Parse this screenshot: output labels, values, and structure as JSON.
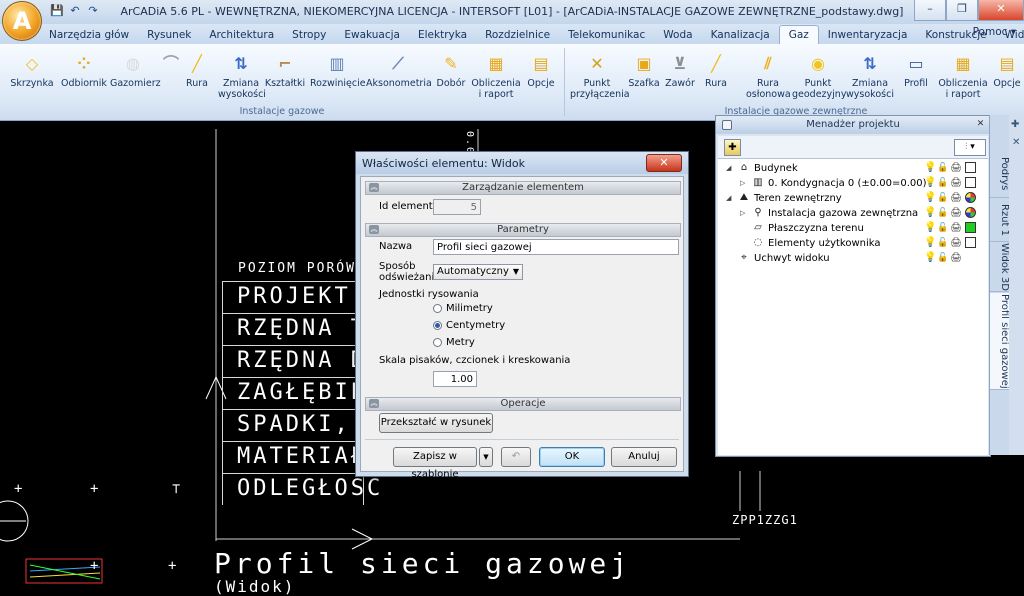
{
  "app": {
    "orb_letter": "A",
    "title": "ArCADiA 5.6 PL - WEWNĘTRZNA, NIEKOMERCYJNA LICENCJA - INTERSOFT [L01] - [ArCADiA-INSTALACJE GAZOWE ZEWNĘTRZNE_podstawy.dwg]",
    "qat": [
      "💾",
      "↶",
      "↷"
    ],
    "window_controls": [
      "–",
      "❐",
      "✕"
    ]
  },
  "ribbon": {
    "tabs": [
      {
        "label": "Narzędzia głów",
        "active": false
      },
      {
        "label": "Rysunek",
        "active": false
      },
      {
        "label": "Architektura",
        "active": false
      },
      {
        "label": "Stropy",
        "active": false
      },
      {
        "label": "Ewakuacja",
        "active": false
      },
      {
        "label": "Elektryka",
        "active": false
      },
      {
        "label": "Rozdzielnice",
        "active": false
      },
      {
        "label": "Telekomunikac",
        "active": false
      },
      {
        "label": "Woda",
        "active": false
      },
      {
        "label": "Kanalizacja",
        "active": false
      },
      {
        "label": "Gaz",
        "active": true
      },
      {
        "label": "Inwentaryzacja",
        "active": false
      },
      {
        "label": "Konstrukcje",
        "active": false
      },
      {
        "label": "Widok",
        "active": false
      }
    ],
    "help": "Pomoc",
    "group1": {
      "label": "Instalacje gazowe",
      "buttons": [
        {
          "label": "Skrzynka",
          "icon": "◇"
        },
        {
          "label": "Odbiornik",
          "icon": "⁘"
        },
        {
          "label": "Gazomierz",
          "icon": "◍"
        },
        {
          "label": "",
          "icon": "⌒"
        },
        {
          "label": "Rura",
          "icon": "╱"
        },
        {
          "label": "Zmiana wysokości",
          "icon": "⇅"
        },
        {
          "label": "Kształtki",
          "icon": "⌐"
        },
        {
          "label": "Rozwinięcie",
          "icon": "▥"
        },
        {
          "label": "Aksonometria",
          "icon": "⟋"
        },
        {
          "label": "Dobór",
          "icon": "✎"
        },
        {
          "label": "Obliczenia i raport",
          "icon": "▦"
        },
        {
          "label": "Opcje",
          "icon": "▤"
        }
      ]
    },
    "group2": {
      "label": "Instalacje gazowe zewnętrzne",
      "buttons": [
        {
          "label": "Punkt przyłączenia",
          "icon": "✕"
        },
        {
          "label": "Szafka",
          "icon": "▣"
        },
        {
          "label": "Zawór",
          "icon": "⊻"
        },
        {
          "label": "Rura",
          "icon": "╱"
        },
        {
          "label": "Rura osłonowa",
          "icon": "⫽"
        },
        {
          "label": "Punkt geodezyjny",
          "icon": "◉"
        },
        {
          "label": "Zmiana wysokości",
          "icon": "⇅"
        },
        {
          "label": "Profil",
          "icon": "▭"
        },
        {
          "label": "Obliczenia i raport",
          "icon": "▦"
        },
        {
          "label": "Opcje",
          "icon": "▤"
        }
      ]
    }
  },
  "cad": {
    "header_label": "POZIOM PORÓWN",
    "rows": [
      "PROJEKT",
      "RZĘDNA T",
      "RZĘDNA D",
      "ZAGŁĘBIE",
      "SPADKI, I",
      "MATERIAŁ",
      "ODLEGŁOŚĆ"
    ],
    "vertical_marker": "0.00",
    "point_label": "ZPP1ZZG1",
    "profile_title": "Profil sieci gazowej",
    "profile_subtitle": "(Widok)"
  },
  "dialog": {
    "title": "Właściwości elementu: Widok",
    "close_glyph": "✕",
    "sections": {
      "management": "Zarządzanie elementem",
      "parameters": "Parametry",
      "operations": "Operacje"
    },
    "id_label": "Id elementu",
    "id_value": "5",
    "name_label": "Nazwa",
    "name_value": "Profil sieci gazowej",
    "refresh_label_1": "Sposób",
    "refresh_label_2": "odświeżania",
    "refresh_value": "Automatyczny",
    "units_label": "Jednostki rysowania",
    "units": [
      {
        "label": "Milimetry",
        "checked": false
      },
      {
        "label": "Centymetry",
        "checked": true
      },
      {
        "label": "Metry",
        "checked": false
      }
    ],
    "scale_label": "Skala pisaków, czcionek i kreskowania",
    "scale_value": "1.00",
    "convert_button": "Przekształć w rysunek",
    "save_template_button": "Zapisz w szablonie",
    "undo_glyph": "↶",
    "ok_button": "OK",
    "cancel_button": "Anuluj"
  },
  "project_manager": {
    "title": "Menadżer projektu",
    "close_glyph": "✕",
    "tree": [
      {
        "label": "Budynek",
        "level": 0,
        "expander": "◢",
        "icon": "⌂",
        "box": "white"
      },
      {
        "label": "0. Kondygnacja 0 (±0.00=0.00)",
        "level": 1,
        "expander": "▷",
        "icon": "▥",
        "box": "white"
      },
      {
        "label": "Teren zewnętrzny",
        "level": 0,
        "expander": "◢",
        "icon": "⛰",
        "box": "multi"
      },
      {
        "label": "Instalacja gazowa zewnętrzna",
        "level": 1,
        "expander": "▷",
        "icon": "⚲",
        "box": "multi"
      },
      {
        "label": "Płaszczyzna terenu",
        "level": 1,
        "expander": "",
        "icon": "▱",
        "box": "green"
      },
      {
        "label": "Elementy użytkownika",
        "level": 1,
        "expander": "",
        "icon": "◌",
        "box": "white"
      },
      {
        "label": "Uchwyt widoku",
        "level": 0,
        "expander": "",
        "icon": "⌖",
        "box": "none"
      }
    ]
  },
  "side_tabs": [
    "Podrys",
    "Rzut 1",
    "Widok 3D",
    "Profil sieci gazowej"
  ]
}
